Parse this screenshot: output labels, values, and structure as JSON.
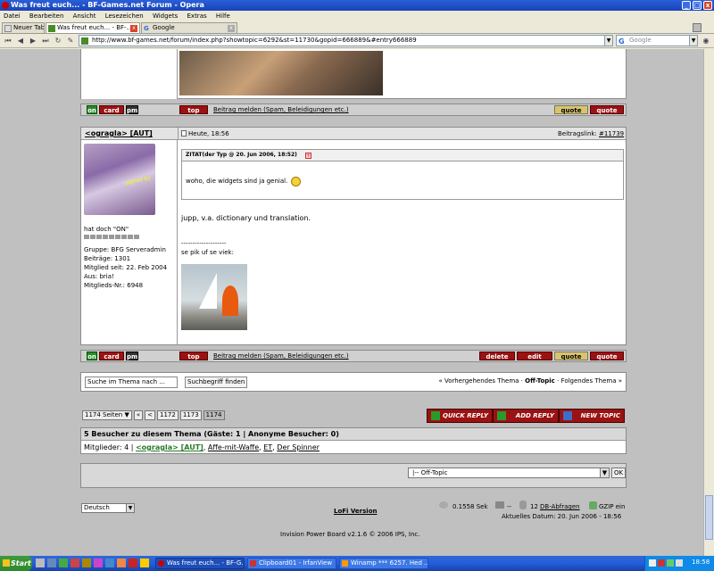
{
  "window": {
    "title": "Was freut euch... - BF-Games.net Forum - Opera",
    "min": "_",
    "max": "□",
    "close": "x"
  },
  "menu": [
    "Datei",
    "Bearbeiten",
    "Ansicht",
    "Lesezeichen",
    "Widgets",
    "Extras",
    "Hilfe"
  ],
  "tabs": [
    {
      "label": "Neuer Tab"
    },
    {
      "label": "Was freut euch... - BF-..."
    },
    {
      "label": "Google"
    }
  ],
  "address": {
    "url": "http://www.bf-games.net/forum/index.php?showtopic=6292&st=11730&gopid=666889&#entry666889",
    "search_value": "Google"
  },
  "post_top": {
    "actions": {
      "on": "on",
      "card": "card",
      "pm": "pm",
      "top": "top",
      "report": "Beitrag melden (Spam, Beleidigungen etc.)",
      "plus_quote": "quote",
      "quote": "quote"
    }
  },
  "post": {
    "author": "<ogragla> [AUT]",
    "date": "Heute, 18:56",
    "link_label": "Beitragslink:",
    "link_value": "#11739",
    "avatar_caption": "signed by",
    "profile": {
      "status": "hat doch \"ON\"",
      "group": "Gruppe: BFG Serveradmin",
      "posts": "Beiträge: 1301",
      "member_since": "Mitglied seit: 22. Feb 2004",
      "from": "Aus: bria!",
      "member_nr": "Mitglieds-Nr.: 6948"
    },
    "quote_header": "ZITAT(der Typ @ 20. Jun 2006, 18:52)",
    "quote_text": "woho, die widgets sind ja genial.",
    "body": "jupp, v.a. dictionary und translation.",
    "sig_line": "--------------------",
    "sig_text": "se pik uf se viek:",
    "actions": {
      "on": "on",
      "card": "card",
      "pm": "pm",
      "top": "top",
      "report": "Beitrag melden (Spam, Beleidigungen etc.)",
      "delete": "delete",
      "edit": "edit",
      "plus_quote": "quote",
      "quote": "quote"
    }
  },
  "search_row": {
    "input_value": "Suche im Thema nach ...",
    "button": "Suchbegriff finden",
    "prev": "« Vorhergehendes Thema",
    "sep1": "·",
    "current": "Off-Topic",
    "sep2": "·",
    "next": "Folgendes Thema »"
  },
  "pagination": {
    "pages": "1174 Seiten",
    "first": "«",
    "prev": "<",
    "p1": "1172",
    "p2": "1173",
    "p3": "1174"
  },
  "big_buttons": {
    "quick": "QUICK REPLY",
    "add": "ADD REPLY",
    "new": "NEW TOPIC"
  },
  "visitors": {
    "title": "5 Besucher zu diesem Thema (Gäste: 1 | Anonyme Besucher: 0)",
    "prefix": "Mitglieder: 4 |",
    "members": [
      "<ogragla> [AUT]",
      "Affe-mit-Waffe",
      "ET",
      "Der Spinner"
    ],
    "sep": ","
  },
  "forum_jump": {
    "value": "|-- Off-Topic",
    "ok": "OK"
  },
  "footer": {
    "language": "Deutsch",
    "lofi": "LoFi Version",
    "time": "0.1558 Sek",
    "dash": "--",
    "queries_num": "12",
    "queries": "DB-Abfragen",
    "gzip": "GZIP ein",
    "date": "Aktuelles Datum: 20. Jun 2006 - 18:56",
    "copyright": "Invision Power Board v2.1.6 © 2006  IPS, Inc."
  },
  "taskbar": {
    "start": "Start",
    "tasks": [
      "Was freut euch... - BF-G...",
      "Clipboard01 - IrfanView",
      "Winamp *** 6257. Hed ..."
    ],
    "clock": "18:58"
  }
}
